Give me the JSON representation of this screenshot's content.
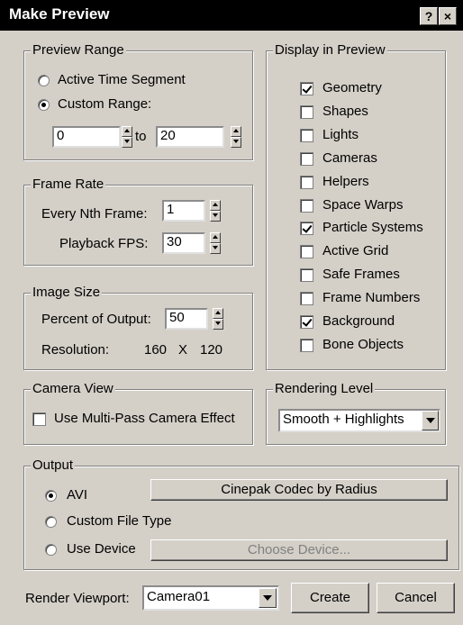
{
  "window": {
    "title": "Make Preview",
    "help_label": "?",
    "close_label": "×"
  },
  "preview_range": {
    "label": "Preview Range",
    "active_time_segment": "Active Time Segment",
    "custom_range": "Custom Range:",
    "selected": "custom_range",
    "from_value": "0",
    "to_label": "to",
    "to_value": "20"
  },
  "frame_rate": {
    "label": "Frame Rate",
    "every_nth_label": "Every Nth Frame:",
    "every_nth_value": "1",
    "playback_fps_label": "Playback FPS:",
    "playback_fps_value": "30"
  },
  "image_size": {
    "label": "Image Size",
    "percent_label": "Percent of Output:",
    "percent_value": "50",
    "resolution_label": "Resolution:",
    "res_width": "160",
    "res_x": "X",
    "res_height": "120"
  },
  "display": {
    "label": "Display in Preview",
    "items": [
      {
        "label": "Geometry",
        "checked": true
      },
      {
        "label": "Shapes",
        "checked": false
      },
      {
        "label": "Lights",
        "checked": false
      },
      {
        "label": "Cameras",
        "checked": false
      },
      {
        "label": "Helpers",
        "checked": false
      },
      {
        "label": "Space Warps",
        "checked": false
      },
      {
        "label": "Particle Systems",
        "checked": true
      },
      {
        "label": "Active Grid",
        "checked": false
      },
      {
        "label": "Safe Frames",
        "checked": false
      },
      {
        "label": "Frame Numbers",
        "checked": false
      },
      {
        "label": "Background",
        "checked": true
      },
      {
        "label": "Bone Objects",
        "checked": false
      }
    ]
  },
  "camera_view": {
    "label": "Camera View",
    "multipass": "Use Multi-Pass Camera Effect",
    "multipass_checked": false
  },
  "rendering_level": {
    "label": "Rendering Level",
    "value": "Smooth + Highlights"
  },
  "output": {
    "label": "Output",
    "avi": "AVI",
    "custom": "Custom File Type",
    "device": "Use Device",
    "selected": "avi",
    "codec_button": "Cinepak Codec by Radius",
    "choose_device_button": "Choose Device..."
  },
  "footer": {
    "render_viewport_label": "Render Viewport:",
    "viewport_value": "Camera01",
    "create": "Create",
    "cancel": "Cancel"
  }
}
